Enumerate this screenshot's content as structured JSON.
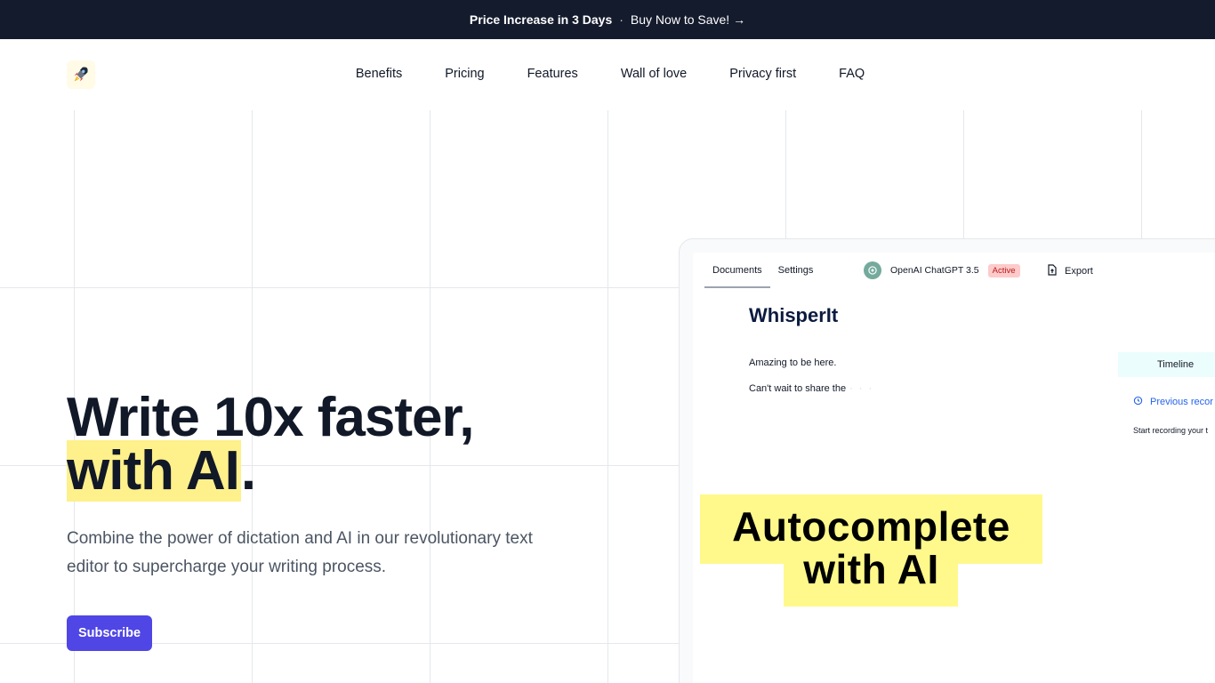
{
  "promo": {
    "highlight": "Price Increase in 3 Days",
    "separator": "·",
    "cta": "Buy Now to Save! →"
  },
  "logo": {
    "icon": "rocket-icon"
  },
  "nav": {
    "items": [
      "Benefits",
      "Pricing",
      "Features",
      "Wall of love",
      "Privacy first",
      "FAQ"
    ]
  },
  "hero": {
    "title_line1": "Write 10x faster,",
    "title_highlight": "with AI",
    "title_end": ".",
    "subtitle": "Combine the power of dictation and AI in our revolutionary text editor to supercharge your writing process.",
    "subscribe_label": "Subscribe",
    "accent_color": "#4f46e5",
    "highlight_color": "#fef08a"
  },
  "app": {
    "tabs": [
      "Documents",
      "Settings"
    ],
    "model_name": "OpenAI ChatGPT 3.5",
    "model_status": "Active",
    "export_label": "Export",
    "doc_title": "WhisperIt",
    "lines": [
      "Amazing to be here.",
      "Can't wait to share the"
    ],
    "typing_dots": "· · ·",
    "timeline_label": "Timeline",
    "previous_label": "Previous recor",
    "start_label": "Start recording your t"
  },
  "overlay": {
    "line1": "Autocomplete",
    "line2": "with AI"
  }
}
